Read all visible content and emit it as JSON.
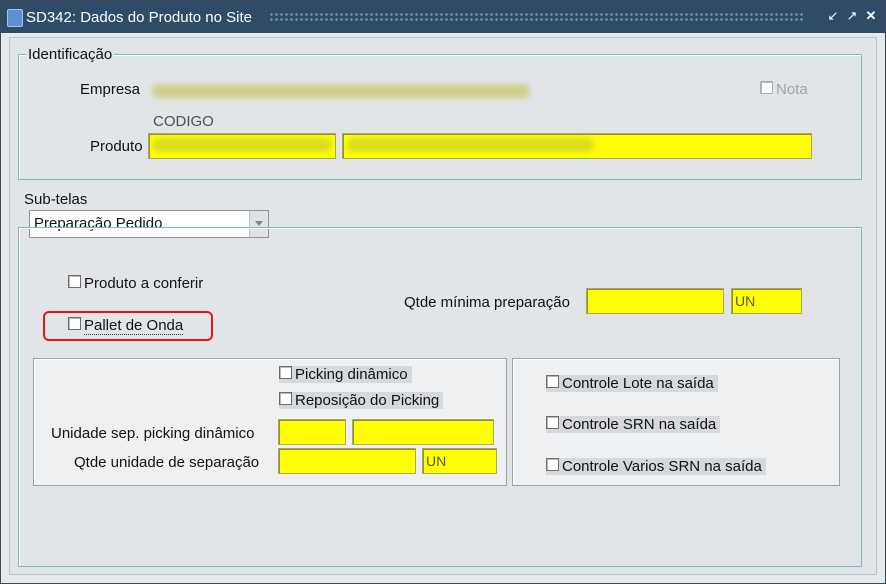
{
  "window": {
    "title": "SD342: Dados do Produto no Site",
    "controls": [
      "restore-icon",
      "maximize-icon",
      "close-icon"
    ]
  },
  "identificacao": {
    "section_title": "Identificação",
    "empresa_label": "Empresa",
    "nota_label": "Nota",
    "codigo_header": "CODIGO",
    "produto_label": "Produto"
  },
  "subtelas": {
    "label": "Sub-telas",
    "selected": "Preparação Pedido"
  },
  "preparacao": {
    "produto_a_conferir": "Produto a conferir",
    "pallet_de_onda": "Pallet de Onda",
    "qtde_minima_label": "Qtde mínima preparação",
    "qtde_minima_unit": "UN"
  },
  "picking": {
    "picking_dinamico": "Picking dinâmico",
    "reposicao_picking": "Reposição do Picking",
    "unidade_sep_label": "Unidade sep. picking dinâmico",
    "qtde_unidade_label": "Qtde unidade de separação",
    "qtde_unidade_unit": "UN"
  },
  "controles": {
    "lote": "Controle Lote na saída",
    "srn": "Controle SRN na saída",
    "varios_srn": "Controle Varios SRN na saída"
  },
  "colors": {
    "titlebar": "#2f4b66",
    "required_field": "#ffff00",
    "highlight": "#e0161b"
  }
}
